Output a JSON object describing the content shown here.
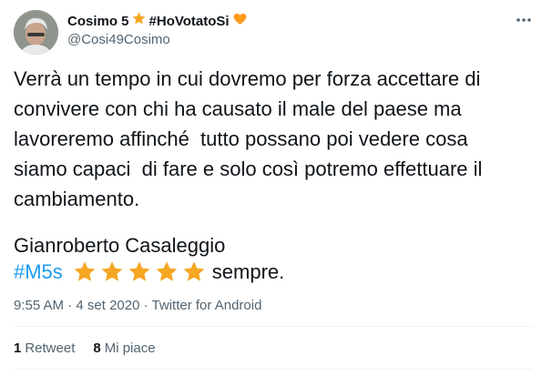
{
  "user": {
    "display_name": "Cosimo 5",
    "display_hashtag": "#HoVotatoSi",
    "handle": "@Cosi49Cosimo"
  },
  "tweet": {
    "body": "Verrà un tempo in cui dovremo per forza accettare di\nconvivere con chi ha causato il male del paese ma\nlavoreremo affinché  tutto possano poi vedere cosa\nsiamo capaci  di fare e solo così potremo effettuare il\ncambiamento.",
    "signature": "Gianroberto Casaleggio",
    "hashtag": "#M5s",
    "star_count": 5,
    "closing": "sempre."
  },
  "meta": {
    "time": "9:55 AM",
    "date": "4 set 2020",
    "source": "Twitter for Android"
  },
  "stats": {
    "retweets_count": "1",
    "retweets_label": "Retweet",
    "likes_count": "8",
    "likes_label": "Mi piace"
  },
  "icons": {
    "name_badge": "star-emoji-icon",
    "hashtag_badge": "orange-heart-icon",
    "more": "more-dots-icon",
    "tag_emoji": "star-emoji-icon"
  },
  "colors": {
    "star": "#f5a623",
    "heart": "#ff9a1f",
    "link": "#1d9bf0",
    "secondary_text": "#536471"
  }
}
